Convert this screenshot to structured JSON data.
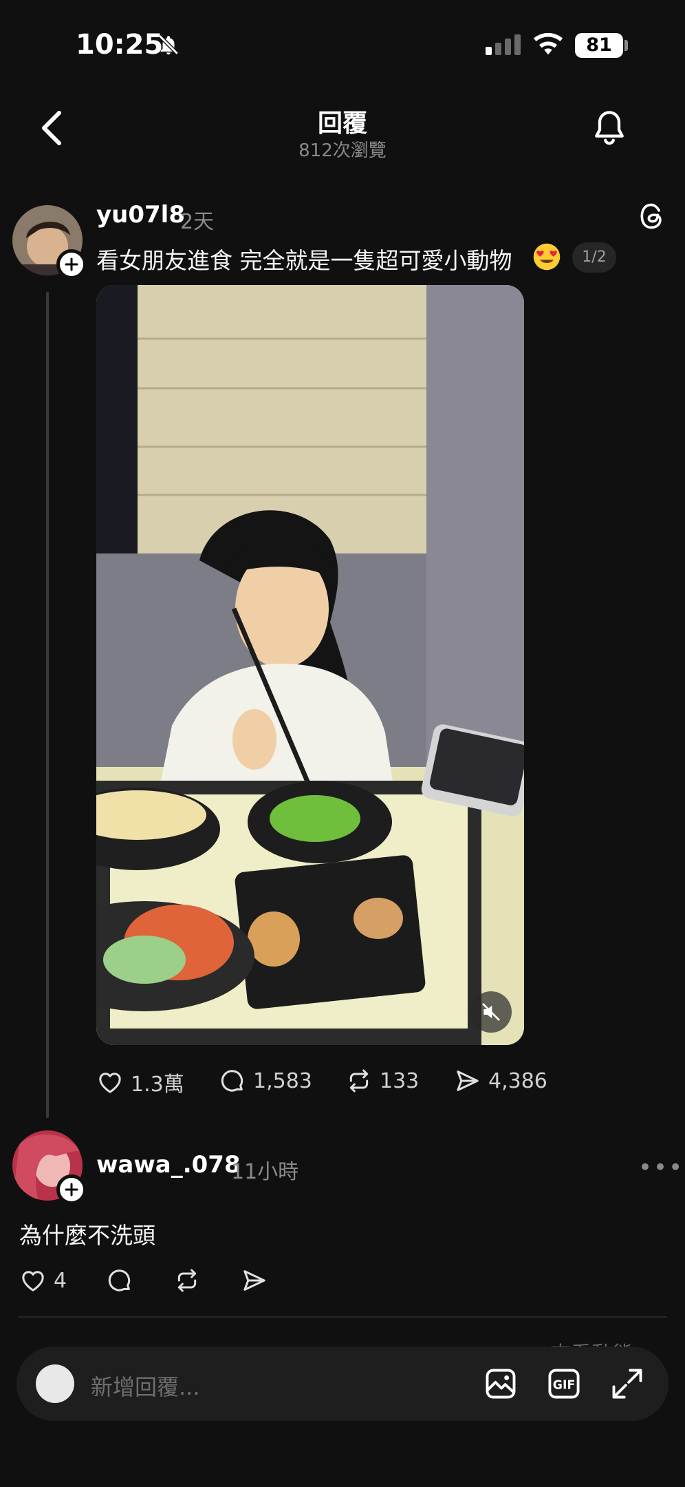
{
  "status_bar": {
    "time": "10:25",
    "battery": "81",
    "icons": [
      "bell-slash-icon",
      "signal-icon",
      "wifi-icon",
      "battery-icon"
    ]
  },
  "header": {
    "title": "回覆",
    "views": "812次瀏覽",
    "icons": [
      "back-chevron-icon",
      "bell-icon"
    ]
  },
  "post": {
    "username": "yu07l8",
    "time": "2天",
    "text": "看女朋友進食 完全就是一隻超可愛小動物",
    "emoji_icon": "heart-eyes-emoji-icon",
    "page_indicator": "1/2",
    "media_icon": "muted-speaker-icon",
    "likes": "1.3萬",
    "comments": "1,583",
    "reposts": "133",
    "shares": "4,386"
  },
  "reply": {
    "username": "wawa_.078",
    "time": "11小時",
    "text": "為什麼不洗頭",
    "likes": "4"
  },
  "peek_text": "查看動態",
  "composer": {
    "placeholder": "新增回覆...",
    "icons": [
      "image-icon",
      "gif-icon",
      "expand-icon"
    ]
  },
  "colors": {
    "background": "#101010",
    "text": "#f3f5f7",
    "muted": "#8a8a8a",
    "composer": "#1e1e1e"
  }
}
